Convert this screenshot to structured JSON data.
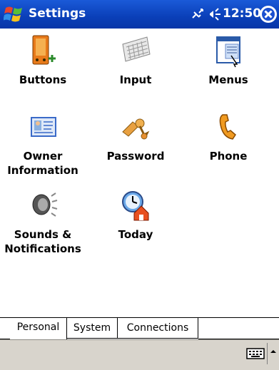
{
  "titlebar": {
    "title": "Settings",
    "time": "12:50"
  },
  "items": [
    {
      "label": "Buttons",
      "icon": "buttons-icon"
    },
    {
      "label": "Input",
      "icon": "keyboard-icon"
    },
    {
      "label": "Menus",
      "icon": "menus-icon"
    },
    {
      "label": "Owner\nInformation",
      "icon": "owner-card-icon"
    },
    {
      "label": "Password",
      "icon": "keys-icon"
    },
    {
      "label": "Phone",
      "icon": "phone-handset-icon"
    },
    {
      "label": "Sounds &\nNotifications",
      "icon": "speaker-icon"
    },
    {
      "label": "Today",
      "icon": "today-icon"
    }
  ],
  "tabs": [
    {
      "label": "Personal",
      "active": true
    },
    {
      "label": "System",
      "active": false
    },
    {
      "label": "Connections",
      "active": false
    }
  ],
  "colors": {
    "titlebar": "#0a3fb8",
    "menubar": "#d8d4cc"
  }
}
